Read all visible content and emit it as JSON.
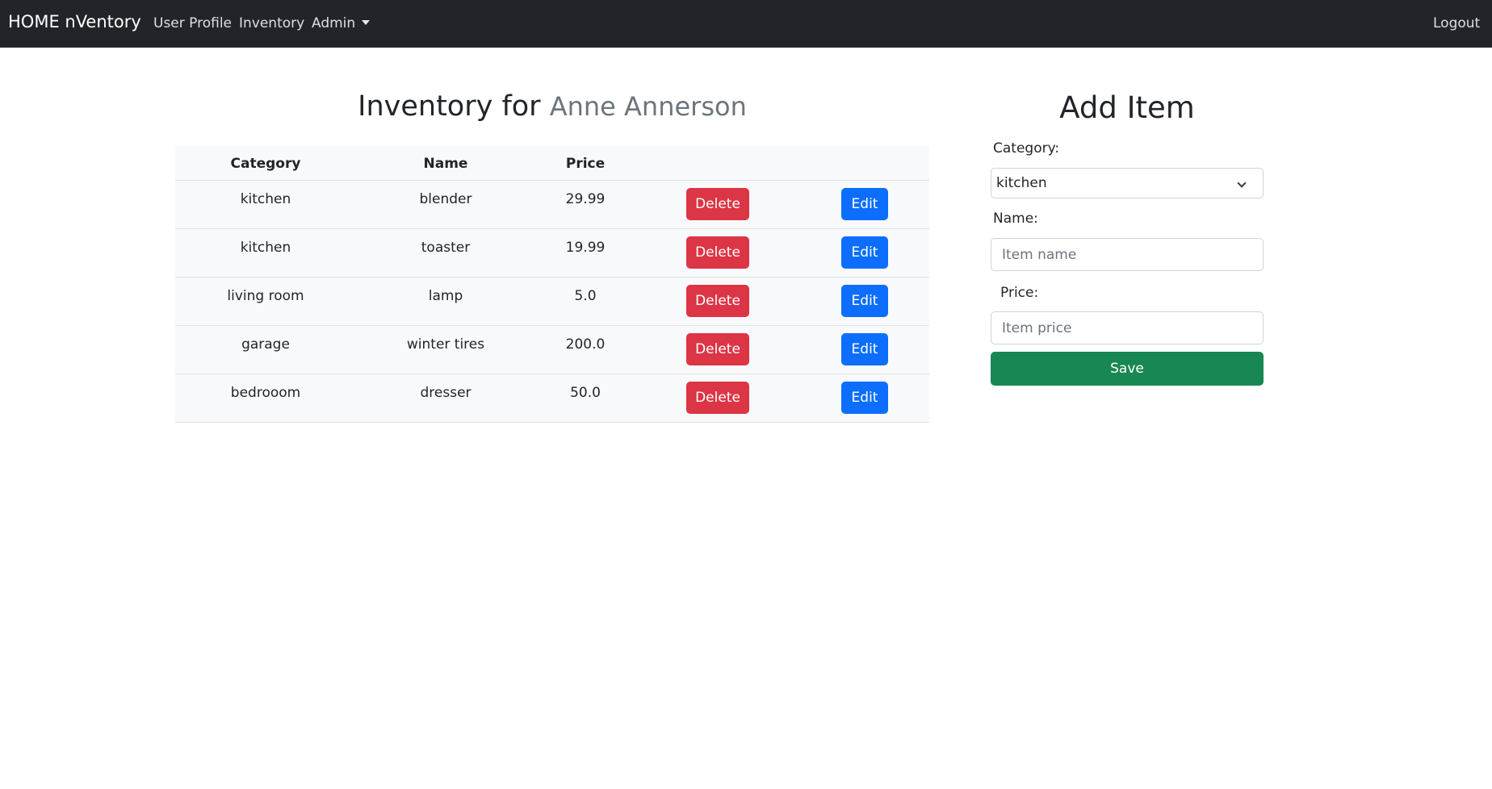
{
  "navbar": {
    "brand": "HOME nVentory",
    "links": [
      "User Profile",
      "Inventory",
      "Admin"
    ],
    "logout": "Logout"
  },
  "inventory": {
    "title_prefix": "Inventory for",
    "owner": "Anne Annerson",
    "headers": [
      "Category",
      "Name",
      "Price"
    ],
    "rows": [
      {
        "category": "kitchen",
        "name": "blender",
        "price": "29.99"
      },
      {
        "category": "kitchen",
        "name": "toaster",
        "price": "19.99"
      },
      {
        "category": "living room",
        "name": "lamp",
        "price": "5.0"
      },
      {
        "category": "garage",
        "name": "winter tires",
        "price": "200.0"
      },
      {
        "category": "bedrooom",
        "name": "dresser",
        "price": "50.0"
      }
    ],
    "delete_label": "Delete",
    "edit_label": "Edit"
  },
  "add_item": {
    "title": "Add Item",
    "category_label": "Category:",
    "category_value": "kitchen",
    "name_label": "Name:",
    "name_placeholder": "Item name",
    "price_label": "Price:",
    "price_placeholder": "Item price",
    "save_label": "Save"
  },
  "colors": {
    "navbar": "#212529",
    "delete": "#dc3545",
    "edit": "#0d6efd",
    "save": "#198754"
  }
}
